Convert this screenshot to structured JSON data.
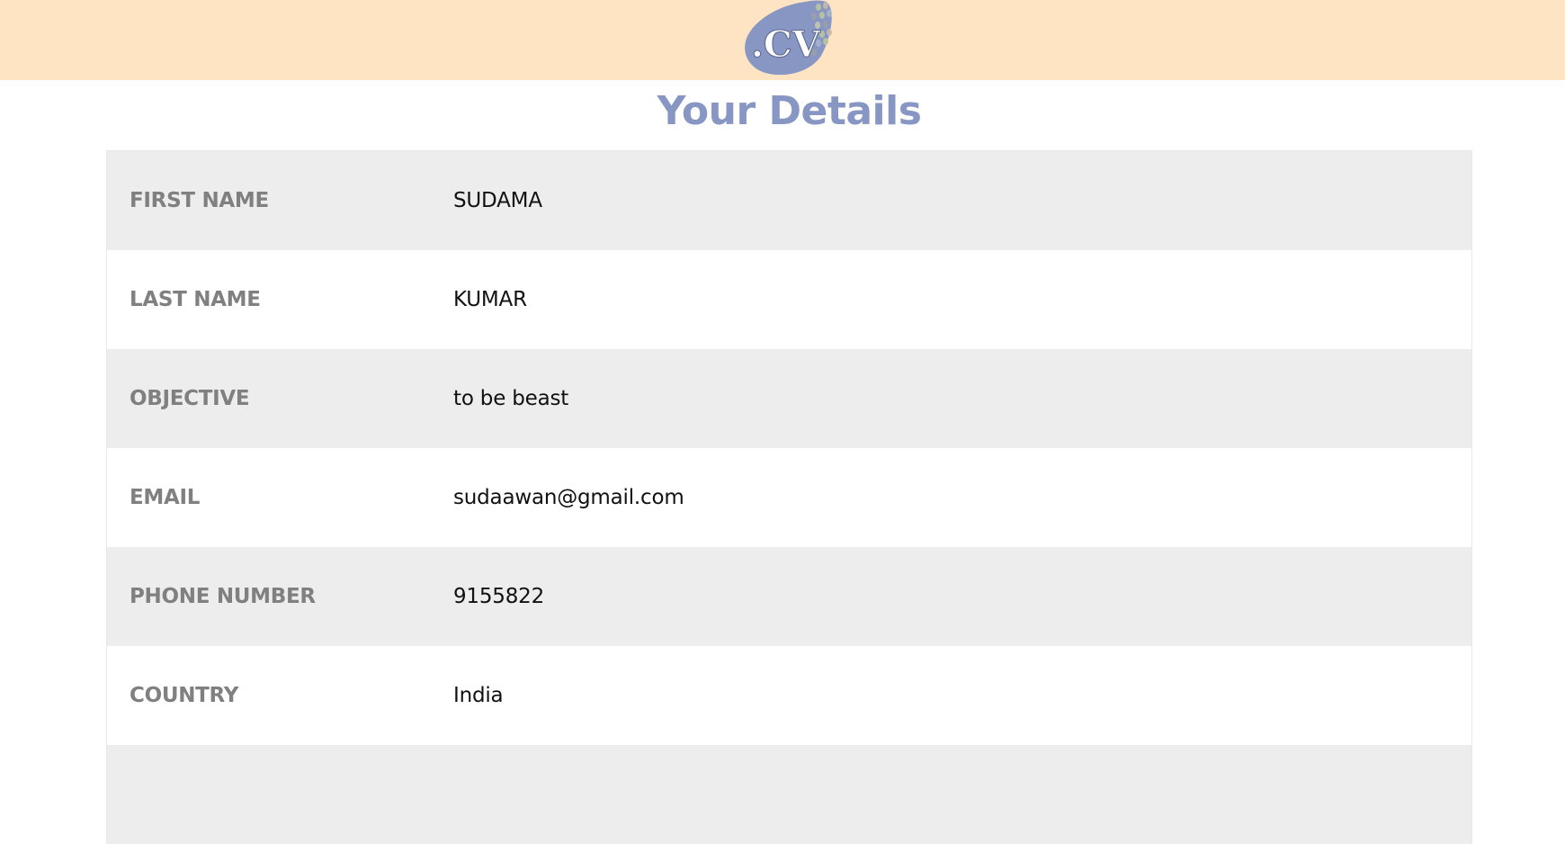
{
  "header": {
    "logo_text": ".CV",
    "background": "#ffe4c4",
    "logo_color": "#8896c3"
  },
  "page": {
    "title": "Your Details",
    "title_color": "#8896c3"
  },
  "details": [
    {
      "label": "FIRST NAME",
      "value": "SUDAMA"
    },
    {
      "label": "LAST NAME",
      "value": "KUMAR"
    },
    {
      "label": "OBJECTIVE",
      "value": "to be beast"
    },
    {
      "label": "EMAIL",
      "value": "sudaawan@gmail.com"
    },
    {
      "label": "PHONE NUMBER",
      "value": "9155822"
    },
    {
      "label": "COUNTRY",
      "value": "India"
    },
    {
      "label": "",
      "value": ""
    }
  ]
}
